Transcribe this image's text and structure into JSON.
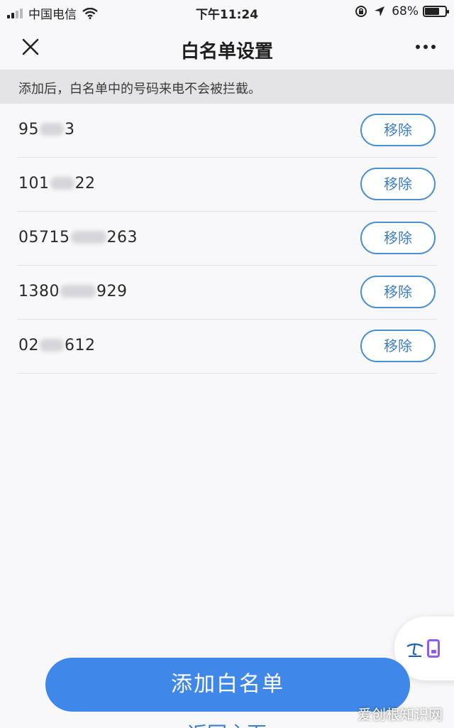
{
  "status_bar": {
    "carrier": "中国电信",
    "time": "下午11:24",
    "battery": "68%"
  },
  "nav": {
    "title": "白名单设置",
    "close_icon": "close-icon",
    "more_icon": "more-icon"
  },
  "notice": "添加后，白名单中的号码来电不会被拦截。",
  "whitelist": {
    "remove_label": "移除",
    "entries": [
      {
        "prefix": "95",
        "suffix": "3"
      },
      {
        "prefix": "101",
        "suffix": "22"
      },
      {
        "prefix": "05715",
        "suffix": "263"
      },
      {
        "prefix": "1380",
        "suffix": "929"
      },
      {
        "prefix": "02",
        "suffix": "612"
      }
    ]
  },
  "floater": {
    "icon": "telecom-logo-icon",
    "card_icon": "card-icon"
  },
  "actions": {
    "add_label": "添加白名单",
    "back_label": "返回主页"
  },
  "watermark": "爱创根知识网",
  "colors": {
    "accent": "#3f87e8",
    "button_border": "#4a8fd0",
    "notice_bg": "#e4e4e6"
  }
}
